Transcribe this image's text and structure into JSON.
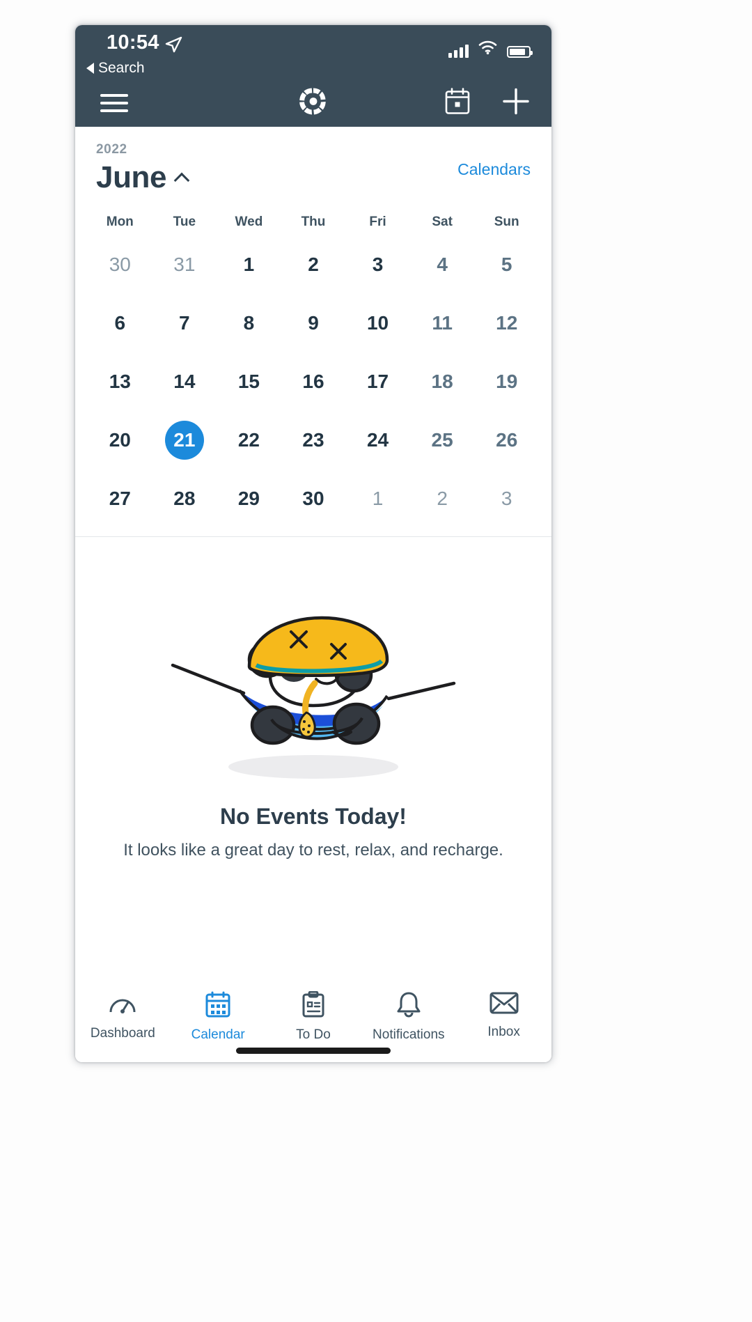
{
  "status_bar": {
    "time": "10:54",
    "location_icon": "location-arrow-icon",
    "back_label": "Search",
    "signal_icon": "cellular-signal-icon",
    "wifi_icon": "wifi-icon",
    "battery_icon": "battery-icon"
  },
  "nav_bar": {
    "menu_icon": "hamburger-menu-icon",
    "logo_icon": "dotted-circle-logo-icon",
    "calendar_icon": "calendar-day-icon",
    "add_icon": "plus-icon"
  },
  "calendar_header": {
    "year": "2022",
    "month": "June",
    "collapse_icon": "chevron-up-icon",
    "calendars_label": "Calendars"
  },
  "weekdays": [
    "Mon",
    "Tue",
    "Wed",
    "Thu",
    "Fri",
    "Sat",
    "Sun"
  ],
  "grid": [
    [
      {
        "n": "30",
        "state": "muted"
      },
      {
        "n": "31",
        "state": "muted"
      },
      {
        "n": "1",
        "state": "normal"
      },
      {
        "n": "2",
        "state": "normal"
      },
      {
        "n": "3",
        "state": "normal"
      },
      {
        "n": "4",
        "state": "weekend"
      },
      {
        "n": "5",
        "state": "weekend"
      }
    ],
    [
      {
        "n": "6",
        "state": "normal"
      },
      {
        "n": "7",
        "state": "normal"
      },
      {
        "n": "8",
        "state": "normal"
      },
      {
        "n": "9",
        "state": "normal"
      },
      {
        "n": "10",
        "state": "normal"
      },
      {
        "n": "11",
        "state": "weekend"
      },
      {
        "n": "12",
        "state": "weekend"
      }
    ],
    [
      {
        "n": "13",
        "state": "normal"
      },
      {
        "n": "14",
        "state": "normal"
      },
      {
        "n": "15",
        "state": "normal"
      },
      {
        "n": "16",
        "state": "normal"
      },
      {
        "n": "17",
        "state": "normal"
      },
      {
        "n": "18",
        "state": "weekend"
      },
      {
        "n": "19",
        "state": "weekend"
      }
    ],
    [
      {
        "n": "20",
        "state": "normal"
      },
      {
        "n": "21",
        "state": "today"
      },
      {
        "n": "22",
        "state": "normal"
      },
      {
        "n": "23",
        "state": "normal"
      },
      {
        "n": "24",
        "state": "normal"
      },
      {
        "n": "25",
        "state": "weekend"
      },
      {
        "n": "26",
        "state": "weekend"
      }
    ],
    [
      {
        "n": "27",
        "state": "normal"
      },
      {
        "n": "28",
        "state": "normal"
      },
      {
        "n": "29",
        "state": "normal"
      },
      {
        "n": "30",
        "state": "normal"
      },
      {
        "n": "1",
        "state": "muted"
      },
      {
        "n": "2",
        "state": "muted"
      },
      {
        "n": "3",
        "state": "muted"
      }
    ]
  ],
  "empty_state": {
    "illustration": "panda-in-hammock-illustration",
    "title": "No Events Today!",
    "subtitle": "It looks like a great day to rest, relax, and recharge."
  },
  "tabs": [
    {
      "label": "Dashboard",
      "icon": "gauge-icon",
      "active": false
    },
    {
      "label": "Calendar",
      "icon": "calendar-icon",
      "active": true
    },
    {
      "label": "To Do",
      "icon": "clipboard-icon",
      "active": false
    },
    {
      "label": "Notifications",
      "icon": "bell-icon",
      "active": false
    },
    {
      "label": "Inbox",
      "icon": "envelope-icon",
      "active": false
    }
  ],
  "colors": {
    "nav_background": "#3a4c59",
    "accent_blue": "#1c8adb",
    "text_dark": "#2d3e4c",
    "text_muted": "#8a9aa6"
  }
}
